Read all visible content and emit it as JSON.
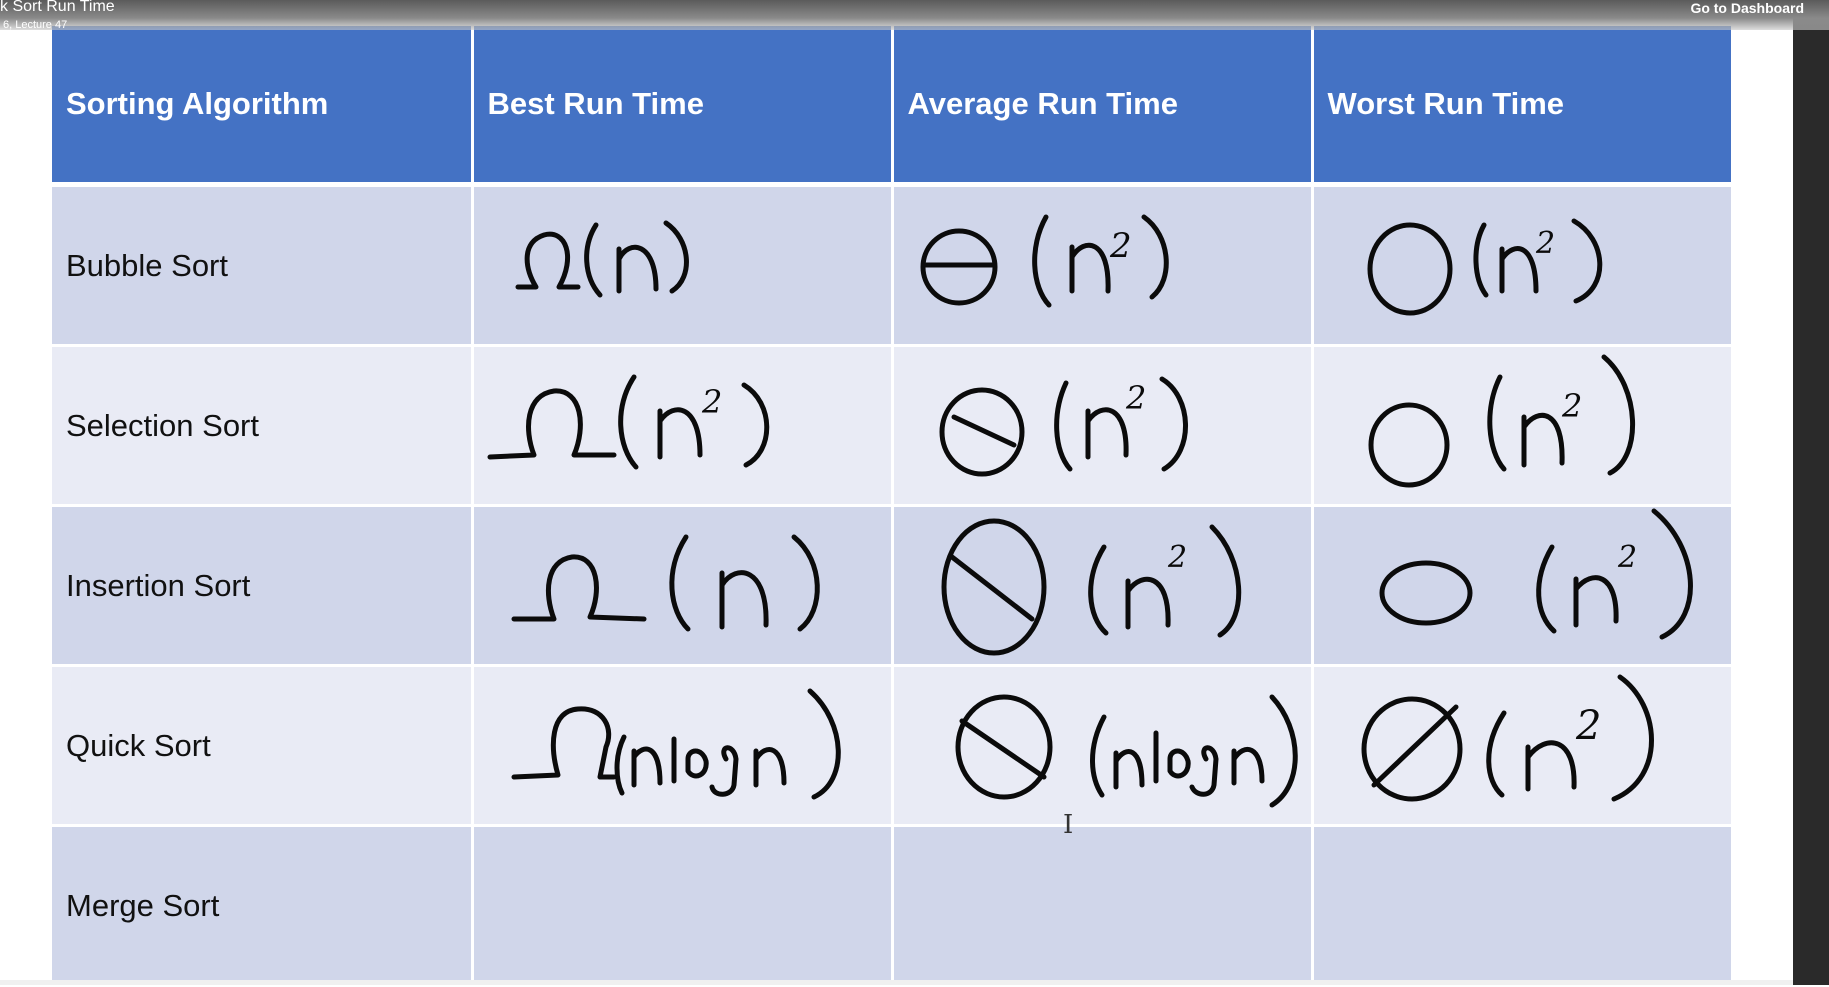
{
  "header": {
    "title": "k Sort Run Time",
    "subtitle": "6, Lecture 47",
    "dashboard_link": "Go to Dashboard"
  },
  "table": {
    "columns": [
      "Sorting Algorithm",
      "Best Run Time",
      "Average Run Time",
      "Worst Run Time"
    ],
    "rows": [
      {
        "algorithm": "Bubble Sort",
        "best": "Ω(n)",
        "average": "Θ(n²)",
        "worst": "O(n²)"
      },
      {
        "algorithm": "Selection Sort",
        "best": "Ω(n²)",
        "average": "Θ(n²)",
        "worst": "O(n²)"
      },
      {
        "algorithm": "Insertion Sort",
        "best": "Ω(n)",
        "average": "Θ(n²)",
        "worst": "O(n²)"
      },
      {
        "algorithm": "Quick Sort",
        "best": "Ω(n log n)",
        "average": "Θ(n log n)",
        "worst": "O(n²)"
      },
      {
        "algorithm": "Merge Sort",
        "best": "",
        "average": "",
        "worst": ""
      }
    ]
  },
  "colors": {
    "header_bg": "#4472c4",
    "row_dark": "#d0d6ea",
    "row_light": "#e9ebf5",
    "ink": "#0b0b0b"
  },
  "icons": {
    "cursor": "text-cursor-icon"
  }
}
